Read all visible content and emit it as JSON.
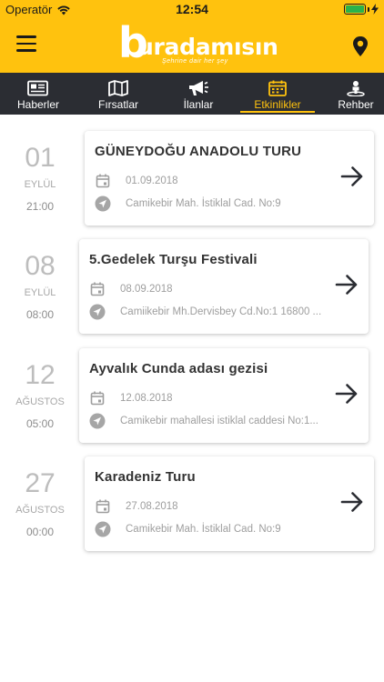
{
  "status_bar": {
    "carrier": "Operatör",
    "time": "12:54"
  },
  "header": {
    "logo_text": "uradamısın",
    "logo_initial": "b",
    "tagline": "Şehrine dair her şey",
    "colors": {
      "accent": "#ffc20e",
      "dark": "#2b2d33"
    }
  },
  "tabs": [
    {
      "label": "Haberler",
      "icon": "newspaper-icon"
    },
    {
      "label": "Fırsatlar",
      "icon": "map-icon"
    },
    {
      "label": "İlanlar",
      "icon": "megaphone-icon"
    },
    {
      "label": "Etkinlikler",
      "icon": "calendar-icon",
      "active": true
    },
    {
      "label": "Rehber",
      "icon": "guide-pin-icon"
    }
  ],
  "events": [
    {
      "day": "01",
      "month": "EYLÜL",
      "time": "21:00",
      "title": "GÜNEYDOĞU ANADOLU TURU",
      "date": "01.09.2018",
      "location": "Camikebir Mah. İstiklal Cad. No:9"
    },
    {
      "day": "08",
      "month": "EYLÜL",
      "time": "08:00",
      "title": "5.Gedelek Turşu Festivali",
      "date": "08.09.2018",
      "location": "Camiikebir Mh.Dervisbey Cd.No:1 16800 ..."
    },
    {
      "day": "12",
      "month": "AĞUSTOS",
      "time": "05:00",
      "title": "Ayvalık Cunda adası gezisi",
      "date": "12.08.2018",
      "location": "Camikebir mahallesi istiklal caddesi No:1..."
    },
    {
      "day": "27",
      "month": "AĞUSTOS",
      "time": "00:00",
      "title": "Karadeniz Turu",
      "date": "27.08.2018",
      "location": "Camikebir Mah. İstiklal Cad. No:9"
    }
  ]
}
